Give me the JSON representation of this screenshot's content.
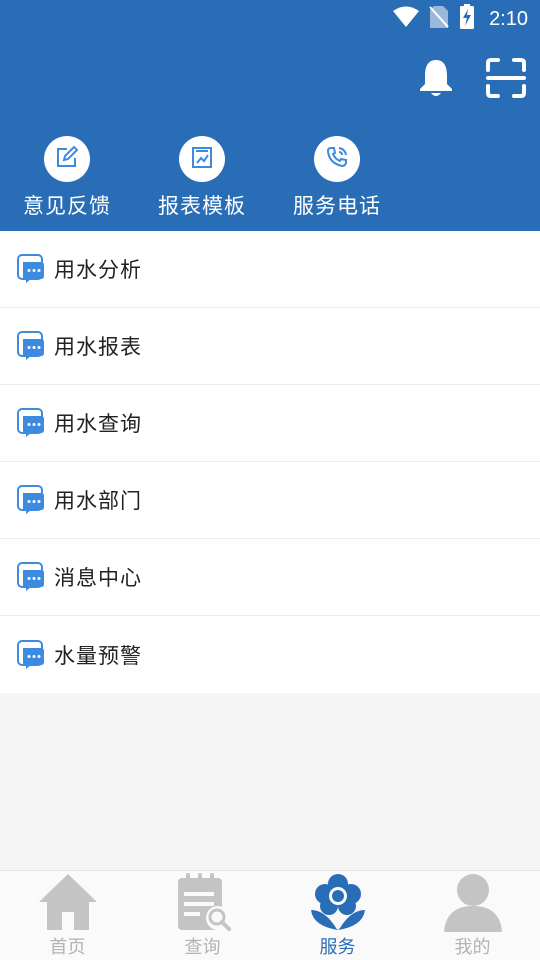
{
  "status_bar": {
    "time": "2:10",
    "icons": [
      "wifi-icon",
      "no-sim-icon",
      "battery-charging-icon"
    ]
  },
  "header": {
    "actions": [
      {
        "name": "notification-bell",
        "icon": "bell-icon"
      },
      {
        "name": "scan-button",
        "icon": "scan-icon"
      }
    ]
  },
  "quick_actions": [
    {
      "label": "意见反馈",
      "icon": "edit-icon"
    },
    {
      "label": "报表模板",
      "icon": "report-icon"
    },
    {
      "label": "服务电话",
      "icon": "phone-icon"
    }
  ],
  "menu_items": [
    {
      "label": "用水分析",
      "icon": "chat-icon"
    },
    {
      "label": "用水报表",
      "icon": "chat-icon"
    },
    {
      "label": "用水查询",
      "icon": "chat-icon"
    },
    {
      "label": "用水部门",
      "icon": "chat-icon"
    },
    {
      "label": "消息中心",
      "icon": "chat-icon"
    },
    {
      "label": "水量预警",
      "icon": "chat-icon"
    }
  ],
  "tab_bar": {
    "active": "服务",
    "tabs": [
      {
        "label": "首页",
        "icon": "home-icon"
      },
      {
        "label": "查询",
        "icon": "query-icon"
      },
      {
        "label": "服务",
        "icon": "flower-icon"
      },
      {
        "label": "我的",
        "icon": "user-icon"
      }
    ]
  },
  "colors": {
    "primary": "#2a6db7",
    "icon_blue": "#3d8be0",
    "tab_inactive": "#b3b3b3",
    "background": "#f5f5f5"
  }
}
